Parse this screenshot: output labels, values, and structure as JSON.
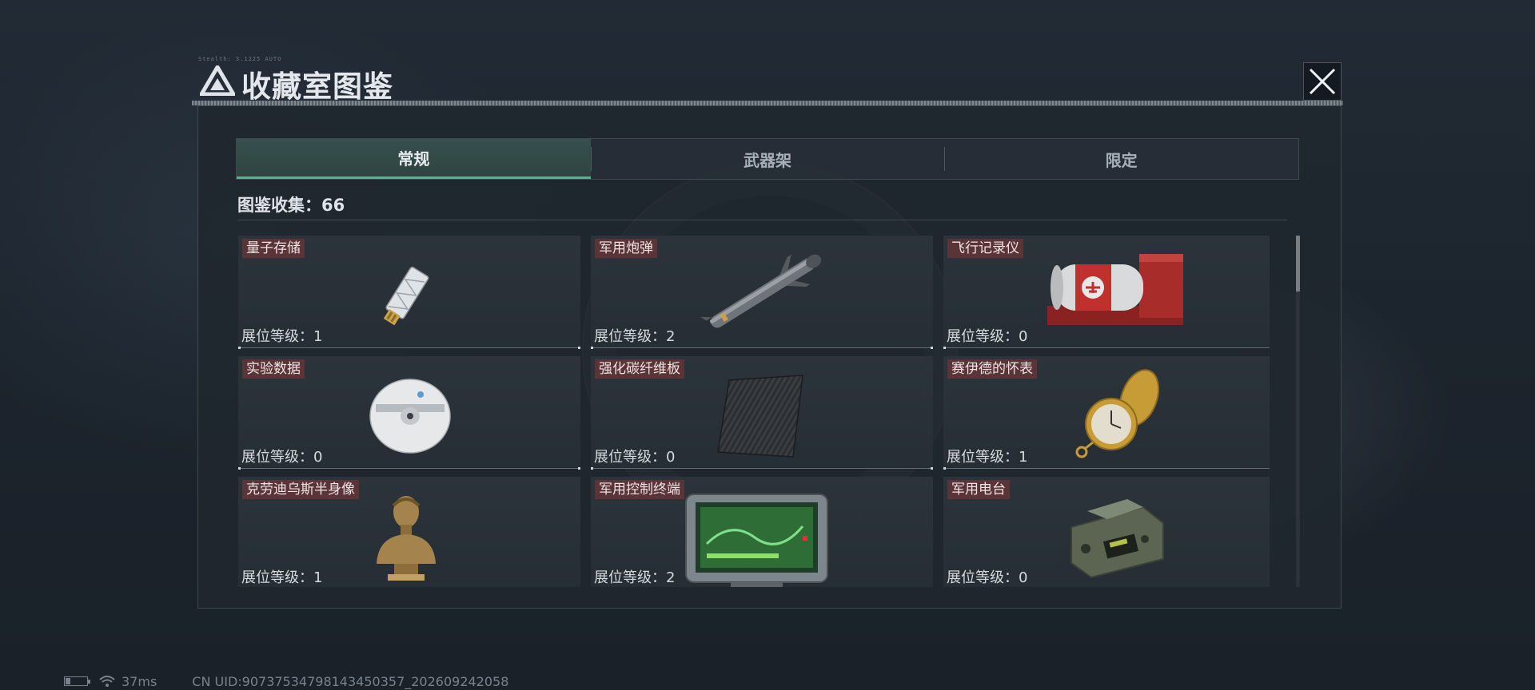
{
  "title": {
    "code_text": "Stealth: 3.1225  AUTO",
    "text": "收藏室图鉴"
  },
  "tabs": [
    {
      "label": "常规",
      "active": true
    },
    {
      "label": "武器架",
      "active": false
    },
    {
      "label": "限定",
      "active": false
    }
  ],
  "collection": {
    "text": "图鉴收集：66"
  },
  "items": [
    {
      "name": "量子存储",
      "level": "展位等级：1",
      "icon": "usb-drive-icon"
    },
    {
      "name": "军用炮弹",
      "level": "展位等级：2",
      "icon": "missile-icon"
    },
    {
      "name": "飞行记录仪",
      "level": "展位等级：0",
      "icon": "flight-recorder-icon"
    },
    {
      "name": "实验数据",
      "level": "展位等级：0",
      "icon": "disc-icon"
    },
    {
      "name": "强化碳纤维板",
      "level": "展位等级：0",
      "icon": "carbon-plate-icon"
    },
    {
      "name": "赛伊德的怀表",
      "level": "展位等级：1",
      "icon": "pocket-watch-icon"
    },
    {
      "name": "克劳迪乌斯半身像",
      "level": "展位等级：1",
      "icon": "bust-icon"
    },
    {
      "name": "军用控制终端",
      "level": "展位等级：2",
      "icon": "control-terminal-icon"
    },
    {
      "name": "军用电台",
      "level": "展位等级：0",
      "icon": "radio-icon"
    }
  ],
  "status": {
    "ping": "37ms",
    "uid": "CN UID:90737534798143450357_202609242058"
  },
  "colors": {
    "accent_tab": "#3fbf8e",
    "name_tag_bg": "#5a3436"
  }
}
